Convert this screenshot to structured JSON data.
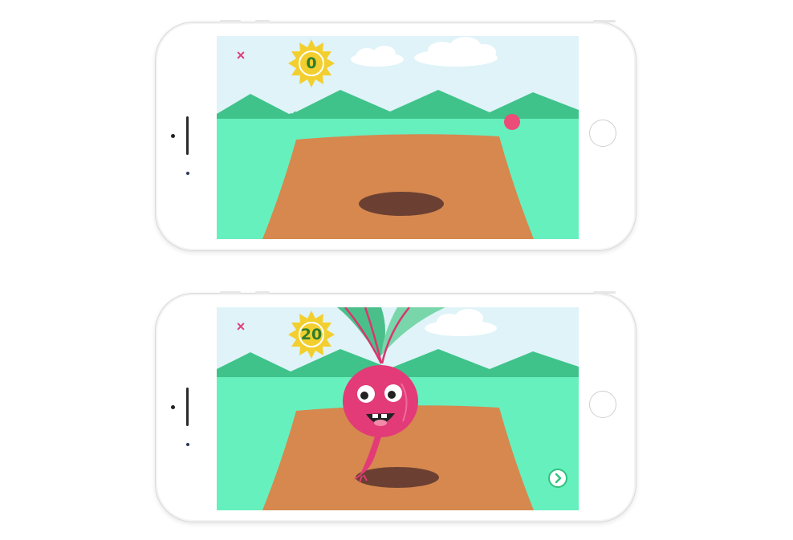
{
  "screens": [
    {
      "close_icon": "×",
      "score": "0"
    },
    {
      "close_icon": "×",
      "score": "20"
    }
  ],
  "colors": {
    "sky": "#dff3f8",
    "hills": "#3fc38a",
    "grass": "#66f0be",
    "soil": "#d6884f",
    "hole": "#6b4032",
    "sun": "#f2cf2e",
    "beet": "#e23b78",
    "leaf": "#4bbf8a"
  }
}
